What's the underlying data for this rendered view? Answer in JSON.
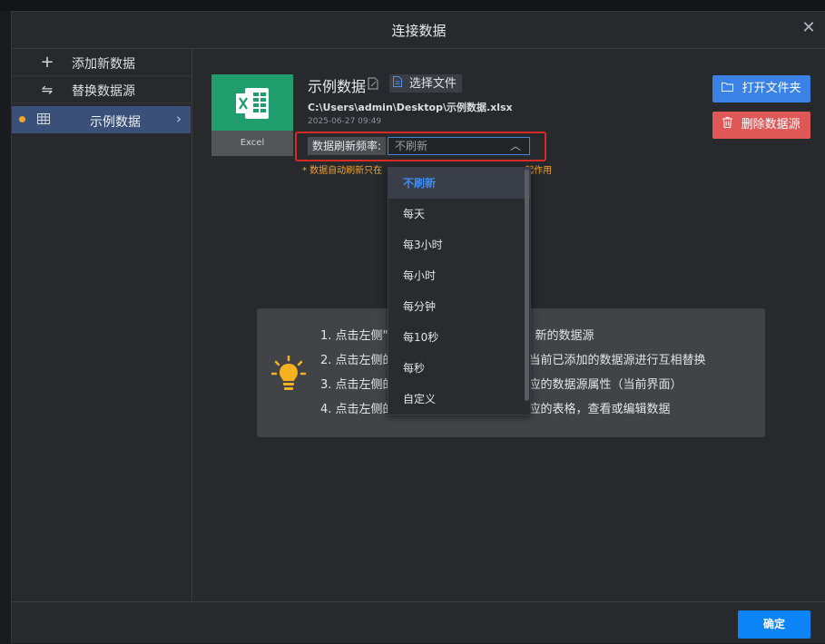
{
  "dialog": {
    "title": "连接数据"
  },
  "sidebar": {
    "add_label": "添加新数据",
    "replace_label": "替换数据源",
    "active_item": {
      "label": "示例数据",
      "status_color": "#f5a523"
    }
  },
  "source": {
    "thumbnail_caption": "Excel",
    "name": "示例数据",
    "choose_file_label": "选择文件",
    "path": "C:\\Users\\admin\\Desktop\\示例数据.xlsx",
    "date": "2025-06-27 09:49",
    "refresh": {
      "label": "数据刷新频率:",
      "selected": "不刷新",
      "note": "* 数据自动刷新只在",
      "note_tail": "起作用",
      "options": [
        "不刷新",
        "每天",
        "每3小时",
        "每小时",
        "每分钟",
        "每10秒",
        "每秒",
        "自定义"
      ]
    }
  },
  "actions": {
    "open_folder": "打开文件夹",
    "delete_source": "删除数据源"
  },
  "tips": {
    "items": [
      "1. 点击左侧\"添",
      "2. 点击左侧的",
      "3. 点击左侧的",
      "4. 点击左侧的"
    ],
    "items_tail": [
      "新的数据源",
      "当前已添加的数据源进行互相替换",
      "应的数据源属性（当前界面）",
      "应的表格，查看或编辑数据"
    ]
  },
  "footer": {
    "confirm_label": "确定"
  },
  "colors": {
    "accent": "#0d84f5",
    "danger": "#e05757",
    "excel_green": "#1f9d6c",
    "highlight_border": "#d62b24",
    "warning_text": "#f6a42a"
  },
  "icons": {
    "close": "close-icon",
    "add": "plus-icon",
    "replace": "swap-icon",
    "table": "table-icon",
    "chevron": "chevron-right-icon",
    "edit": "edit-icon",
    "file": "file-icon",
    "folder": "folder-icon",
    "trash": "trash-icon",
    "bulb": "lightbulb-icon"
  }
}
